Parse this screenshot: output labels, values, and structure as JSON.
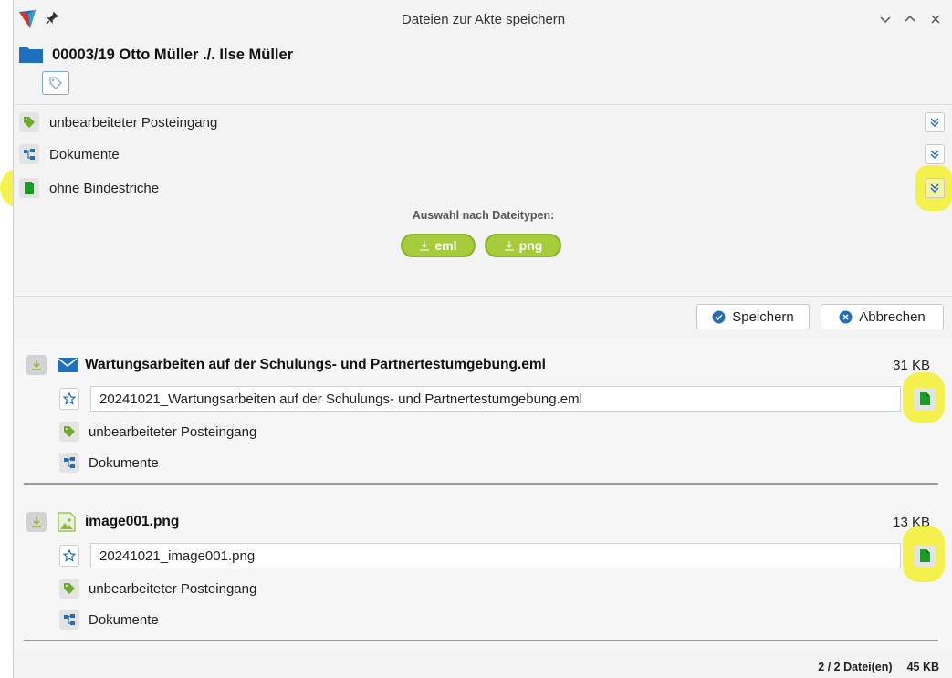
{
  "window": {
    "title": "Dateien zur Akte speichern",
    "icons": [
      "app-logo-icon",
      "pin-icon",
      "minimize-icon",
      "maximize-icon",
      "close-icon"
    ]
  },
  "case": {
    "title": "00003/19 Otto Müller ./. Ilse Müller",
    "icon": "folder-icon",
    "tag_icon": "tag-outline-icon"
  },
  "categories": [
    {
      "label": "unbearbeiteter Posteingang",
      "icon": "tag-icon",
      "highlighted": false
    },
    {
      "label": "Dokumente",
      "icon": "folder-tree-icon",
      "highlighted": false
    },
    {
      "label": "ohne Bindestriche",
      "icon": "document-icon",
      "highlighted": true
    }
  ],
  "type_selection": {
    "label": "Auswahl nach Dateitypen:",
    "chips": [
      "eml",
      "png"
    ]
  },
  "actions": {
    "save_label": "Speichern",
    "cancel_label": "Abbrechen"
  },
  "files": [
    {
      "name": "Wartungsarbeiten auf der Schulungs- und Partnertestumgebung.eml",
      "size": "31 KB",
      "type_icon": "email-icon",
      "target_name": "20241021_Wartungsarbeiten auf der Schulungs- und Partnertestumgebung.eml",
      "tags": [
        "unbearbeiteter Posteingang",
        "Dokumente"
      ]
    },
    {
      "name": "image001.png",
      "size": "13 KB",
      "type_icon": "image-icon",
      "target_name": "20241021_image001.png",
      "tags": [
        "unbearbeiteter Posteingang",
        "Dokumente"
      ]
    }
  ],
  "status": {
    "count": "2 / 2 Datei(en)",
    "total": "45 KB"
  },
  "colors": {
    "accent_blue": "#1f6fbf",
    "chip_green": "#a6cc3b",
    "doc_green": "#1d9b2a",
    "highlight_yellow": "#f3ef1f"
  }
}
